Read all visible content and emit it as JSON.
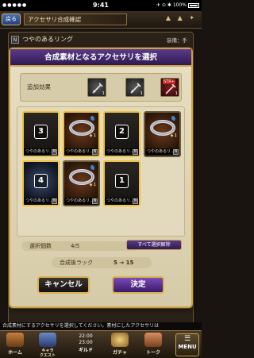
{
  "status": {
    "carrier_dots": "●●●●●",
    "time": "9:41",
    "signal": "✈ ⊙ ✱",
    "battery": "100%"
  },
  "topbar": {
    "back": "戻る",
    "title": "アクセサリ合成確認"
  },
  "background_item": {
    "name": "つやのあるリング",
    "rarity": "N",
    "equip": "装備：手"
  },
  "modal": {
    "title": "合成素材となるアクセサリを選択",
    "effects_label": "追加効果",
    "effects": [
      {
        "icon": "sword-icon",
        "count": "1"
      },
      {
        "icon": "sword-icon",
        "count": "1"
      },
      {
        "icon": "str-icon",
        "tag": "STR+",
        "count": "1"
      }
    ],
    "cards": [
      {
        "type": "dark",
        "number": "3",
        "name": "つやのあるリ...",
        "selected": true
      },
      {
        "type": "ring",
        "name": "つやのあるリ...",
        "level": "1",
        "selected": true
      },
      {
        "type": "dark",
        "number": "2",
        "name": "つやのあるリ...",
        "selected": true
      },
      {
        "type": "ring",
        "name": "つやのあるリ...",
        "level": "1",
        "selected": false
      },
      {
        "type": "sparkle",
        "number": "4",
        "name": "つやのあるリ...",
        "selected": true
      },
      {
        "type": "ring",
        "name": "つやのあるリ...",
        "level": "1",
        "selected": false
      },
      {
        "type": "dark",
        "number": "1",
        "name": "つやのあるリ...",
        "selected": true
      }
    ],
    "selection_label": "選択個数",
    "selection_value": "4/5",
    "clear_label": "すべて選択解除",
    "rank_label": "合成後ラック",
    "rank_value": "5 → 15",
    "cancel_label": "キャンセル",
    "ok_label": "決定"
  },
  "bottom_message": "合成素材にするアクセサリを選択してください。素材にしたアクセサリは",
  "nav": {
    "home": "ホーム",
    "quest": "キャラ\nクエスト",
    "clock_line1": "22:00",
    "clock_line2": "23:00",
    "guild": "ギルド",
    "gacha": "ガチャ",
    "talk": "トーク",
    "menu": "MENU"
  }
}
